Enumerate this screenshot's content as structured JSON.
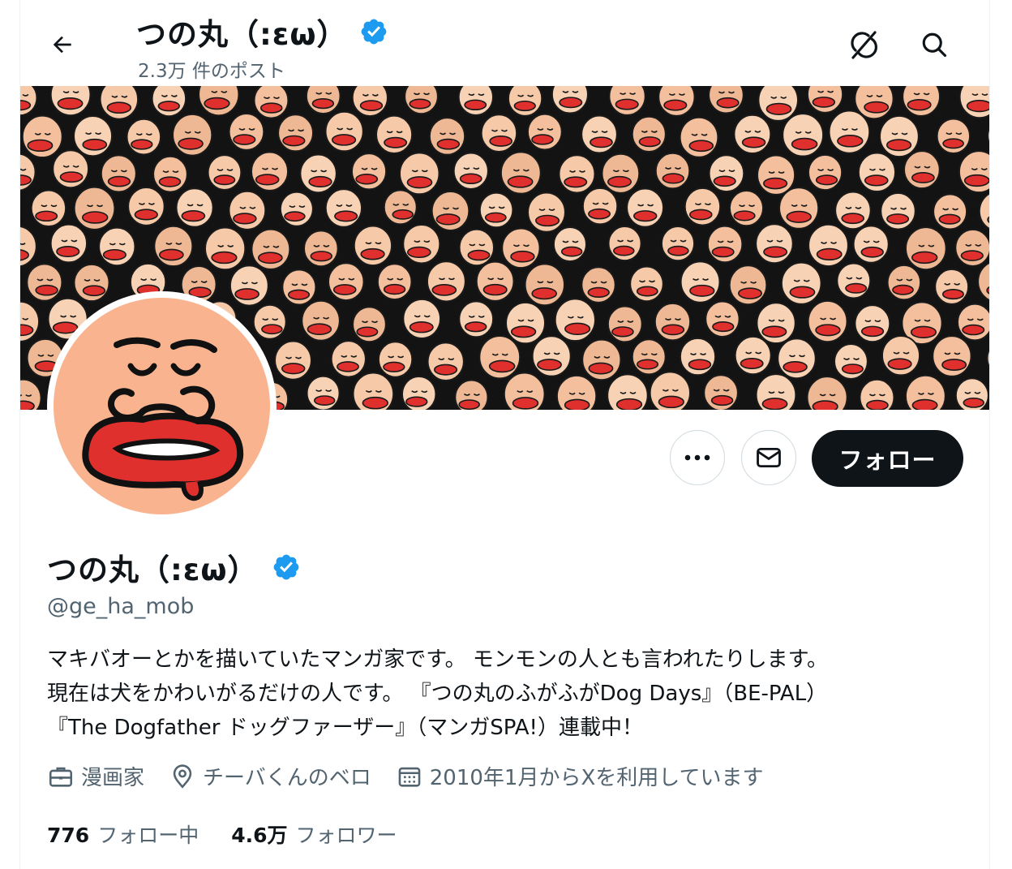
{
  "header": {
    "name": "つの丸（:εω）",
    "post_count": "2.3万 件のポスト"
  },
  "profile": {
    "name": "つの丸（:εω）",
    "handle": "@ge_ha_mob",
    "bio_lines": [
      "マキバオーとかを描いていたマンガ家です。 モンモンの人とも言われたりします。",
      "現在は犬をかわいがるだけの人です。 『つの丸のふがふがDog Days』（BE-PAL）",
      "『The Dogfather ドッグファーザー』（マンガSPA!）連載中！"
    ],
    "profession": "漫画家",
    "location": "チーバくんのベロ",
    "joined": "2010年1月からXを利用しています",
    "following_count": "776",
    "following_label": "フォロー中",
    "followers_count": "4.6万",
    "followers_label": "フォロワー"
  },
  "actions": {
    "follow_label": "フォロー"
  },
  "icons": {
    "back": "arrow-left-icon",
    "grok": "grok-icon",
    "search": "search-icon",
    "more": "more-icon",
    "message": "message-icon",
    "verified": "verified-badge-icon",
    "profession": "briefcase-icon",
    "location": "location-pin-icon",
    "joined": "calendar-icon"
  },
  "colors": {
    "verified": "#1d9bf0",
    "text_primary": "#0f1419",
    "text_secondary": "#536471",
    "follow_bg": "#0f1419",
    "avatar_bg": "#f9b48f",
    "lips": "#e0302d"
  }
}
